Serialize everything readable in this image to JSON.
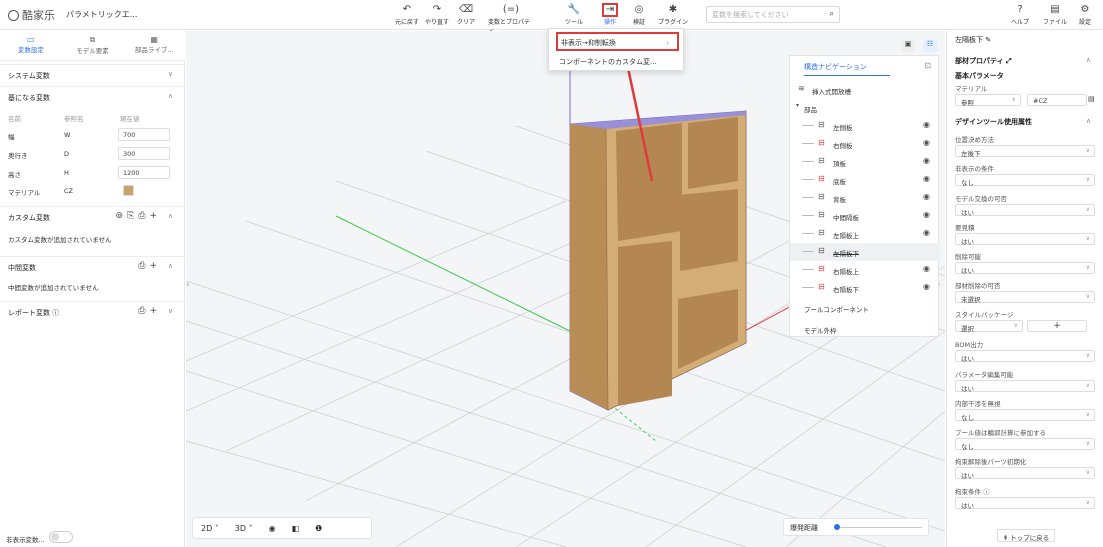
{
  "app": {
    "logo": "酷家乐",
    "project": "パラメトリックエ..."
  },
  "toolbar": {
    "undo": "元に戻す",
    "redo": "やり直す",
    "clear": "クリア",
    "vars": "変数とプロパティ",
    "tools": "ツール",
    "ops": "操作",
    "verify": "検証",
    "plugins": "プラグイン",
    "help": "ヘルプ",
    "file": "ファイル",
    "settings": "設定"
  },
  "search": {
    "placeholder": "変数を検索してください"
  },
  "left": {
    "tabs": [
      "変数設定",
      "モデル要素",
      "部品ライブ..."
    ],
    "system_vars": "システム変数",
    "base_vars": "基になる変数",
    "cols": {
      "name": "名前",
      "ref": "参照名",
      "cur": "現在値"
    },
    "rows": [
      {
        "name": "幅",
        "ref": "W",
        "val": "700"
      },
      {
        "name": "奥行き",
        "ref": "D",
        "val": "300"
      },
      {
        "name": "高さ",
        "ref": "H",
        "val": "1200"
      },
      {
        "name": "マテリアル",
        "ref": "CZ",
        "val": ""
      }
    ],
    "custom_vars": "カスタム変数",
    "custom_empty": "カスタム変数が追加されていません",
    "mid_vars": "中間変数",
    "mid_empty": "中間変数が追加されていません",
    "report_vars": "レポート変数 ⓘ",
    "hidden_vars": "非表示変数..."
  },
  "dropdown": {
    "item1": "非表示→抑制転換",
    "item2": "コンポーネントのカスタム変..."
  },
  "viewport": {
    "mode2d": "2D",
    "mode3d": "3D",
    "explode": "爆発距離"
  },
  "nav": {
    "title": "構造ナビゲーション",
    "insert": "挿入式開放槽",
    "group": "部品",
    "items": [
      "左側板",
      "右側板",
      "頂板",
      "底板",
      "背板",
      "中間隔板",
      "左隔板上",
      "左隔板下",
      "右隔板上",
      "右隔板下"
    ],
    "pool": "プールコンポーネント",
    "model": "モデル外枠"
  },
  "right": {
    "title": "左隔板下",
    "panel_prop": "部材プロパティ",
    "base_param": "基本パラメータ",
    "material": "マテリアル",
    "mat_ref": "参照",
    "mat_val": "#CZ",
    "design_tool": "デザインツール使用属性",
    "fields": [
      {
        "label": "位置決め方法",
        "value": "左後下"
      },
      {
        "label": "非表示の条件",
        "value": "なし"
      },
      {
        "label": "モデル交換の可否",
        "value": "はい"
      },
      {
        "label": "要見積",
        "value": "はい"
      },
      {
        "label": "削除可能",
        "value": "はい"
      },
      {
        "label": "部材削除の可否",
        "value": "未選択"
      },
      {
        "label": "スタイルパッケージ",
        "value": "選択"
      },
      {
        "label": "BOM出力",
        "value": "はい"
      },
      {
        "label": "パラメータ編集可能",
        "value": "はい"
      },
      {
        "label": "内部干渉を無視",
        "value": "なし"
      },
      {
        "label": "プール値は輪郭計算に参加する",
        "value": "なし"
      },
      {
        "label": "拘束解除後パーツ初期化",
        "value": "はい"
      },
      {
        "label": "拘束条件 ⓘ",
        "value": "はい"
      }
    ],
    "back_top": "トップに戻る"
  }
}
